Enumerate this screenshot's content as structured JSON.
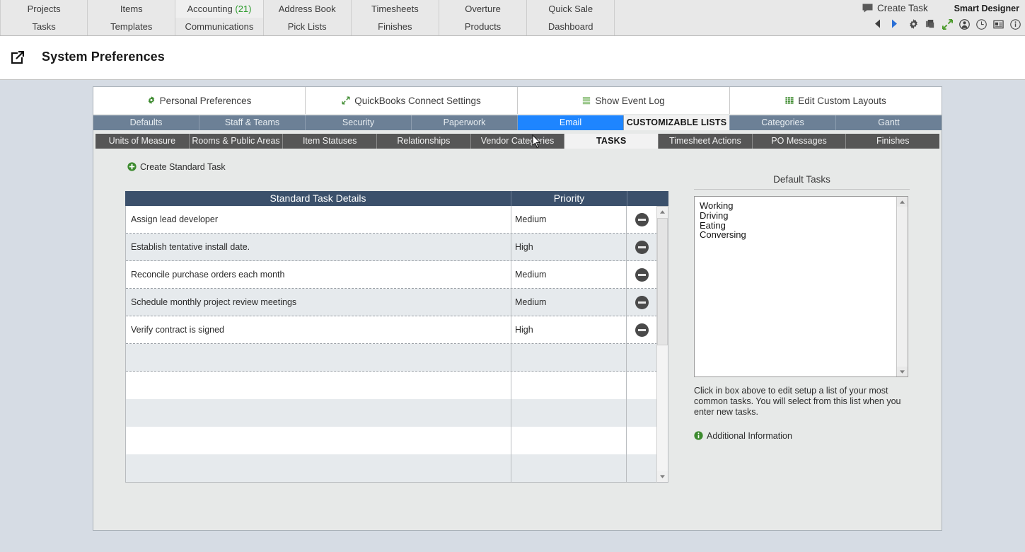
{
  "topnav": {
    "row1": [
      {
        "label": "Projects",
        "count": null
      },
      {
        "label": "Items",
        "count": null
      },
      {
        "label": "Accounting",
        "count": "(21)"
      },
      {
        "label": "Address Book",
        "count": null
      },
      {
        "label": "Timesheets",
        "count": null
      },
      {
        "label": "Overture",
        "count": null
      },
      {
        "label": "Quick Sale",
        "count": null
      }
    ],
    "row2": [
      {
        "label": "Tasks"
      },
      {
        "label": "Templates"
      },
      {
        "label": "Communications"
      },
      {
        "label": "Pick Lists"
      },
      {
        "label": "Finishes"
      },
      {
        "label": "Products"
      },
      {
        "label": "Dashboard"
      }
    ],
    "create_task_label": "Create Task",
    "brand_label": "Smart Designer",
    "icons": [
      "back-arrow-icon",
      "forward-arrow-icon",
      "gear-icon",
      "copy-icon",
      "expand-icon",
      "user-icon",
      "clock-icon",
      "card-icon",
      "info-icon"
    ]
  },
  "header": {
    "title": "System Preferences",
    "icon": "external-link-icon"
  },
  "buttons": [
    {
      "label": "Personal Preferences",
      "icon": "gear-icon"
    },
    {
      "label": "QuickBooks Connect Settings",
      "icon": "expand-arrow-icon"
    },
    {
      "label": "Show Event Log",
      "icon": "list-icon"
    },
    {
      "label": "Edit Custom Layouts",
      "icon": "grid-icon"
    }
  ],
  "tabs_level2": [
    {
      "label": "Defaults",
      "state": "normal"
    },
    {
      "label": "Staff & Teams",
      "state": "normal"
    },
    {
      "label": "Security",
      "state": "normal"
    },
    {
      "label": "Paperwork",
      "state": "normal"
    },
    {
      "label": "Email",
      "state": "highlight"
    },
    {
      "label": "CUSTOMIZABLE LISTS",
      "state": "selected"
    },
    {
      "label": "Categories",
      "state": "normal"
    },
    {
      "label": "Gantt",
      "state": "normal"
    }
  ],
  "tabs_level3": [
    {
      "label": "Units of Measure",
      "state": "normal"
    },
    {
      "label": "Rooms & Public Areas",
      "state": "normal"
    },
    {
      "label": "Item Statuses",
      "state": "normal"
    },
    {
      "label": "Relationships",
      "state": "normal"
    },
    {
      "label": "Vendor Categories",
      "state": "normal"
    },
    {
      "label": "TASKS",
      "state": "selected"
    },
    {
      "label": "Timesheet Actions",
      "state": "normal"
    },
    {
      "label": "PO Messages",
      "state": "normal"
    },
    {
      "label": "Finishes",
      "state": "normal"
    }
  ],
  "main": {
    "create_standard_task_label": "Create Standard Task",
    "table": {
      "columns": [
        "Standard Task Details",
        "Priority",
        ""
      ],
      "rows": [
        {
          "task": "Assign lead developer",
          "priority": "Medium",
          "action": "remove"
        },
        {
          "task": "Establish tentative install date.",
          "priority": "High",
          "action": "remove"
        },
        {
          "task": "Reconcile purchase orders each month",
          "priority": "Medium",
          "action": "remove"
        },
        {
          "task": "Schedule monthly project review meetings",
          "priority": "Medium",
          "action": "remove"
        },
        {
          "task": "Verify contract is signed",
          "priority": "High",
          "action": "remove"
        },
        {
          "task": "",
          "priority": "",
          "action": ""
        },
        {
          "task": "",
          "priority": "",
          "action": ""
        },
        {
          "task": "",
          "priority": "",
          "action": ""
        },
        {
          "task": "",
          "priority": "",
          "action": ""
        },
        {
          "task": "",
          "priority": "",
          "action": ""
        }
      ]
    }
  },
  "side": {
    "title": "Default Tasks",
    "list": [
      "Working",
      "Driving",
      "Eating",
      "Conversing"
    ],
    "help_text": "Click in box above to edit setup a list of your most common tasks. You will select from this list when you enter new tasks.",
    "additional_information_label": "Additional Information"
  },
  "colors": {
    "page_bg": "#d6dce4",
    "panel_bg": "#e7e9e8",
    "tab2_bg": "#6c8096",
    "tab2_highlight": "#1e85ff",
    "tab3_bg": "#565656",
    "table_header": "#3b506b",
    "row_alt": "#e6eaed",
    "accent_green": "#2a9a2a",
    "count_green": "#2a9a2a"
  }
}
